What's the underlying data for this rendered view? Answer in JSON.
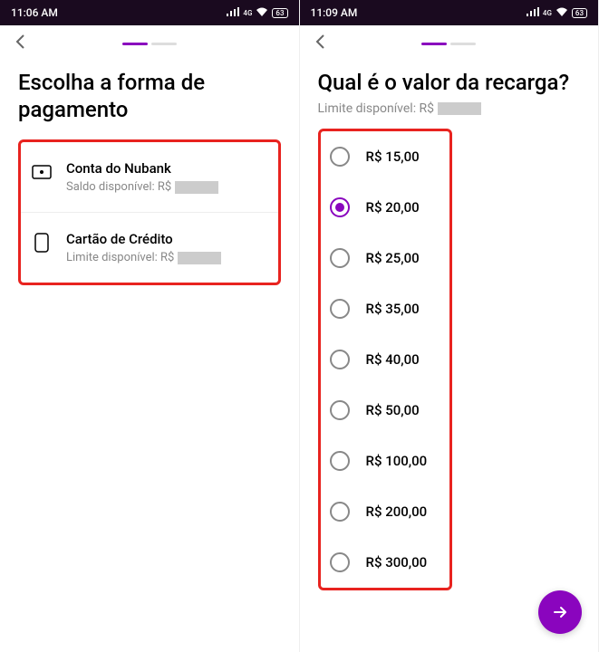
{
  "left": {
    "time": "11:06 AM",
    "title": "Escolha a forma de pagamento",
    "options": [
      {
        "title": "Conta do Nubank",
        "sub": "Saldo disponível: R$"
      },
      {
        "title": "Cartão de Crédito",
        "sub": "Limite disponível: R$"
      }
    ]
  },
  "right": {
    "time": "11:09 AM",
    "title": "Qual é o valor da recarga?",
    "subtitle": "Limite disponível: R$",
    "amounts": [
      "R$ 15,00",
      "R$ 20,00",
      "R$ 25,00",
      "R$ 35,00",
      "R$ 40,00",
      "R$ 50,00",
      "R$ 100,00",
      "R$ 200,00",
      "R$ 300,00"
    ],
    "selectedIndex": 1
  },
  "statusIcons": {
    "signal": "␠ıll",
    "lte": "4G",
    "wifi": "◇",
    "battery": "63"
  }
}
